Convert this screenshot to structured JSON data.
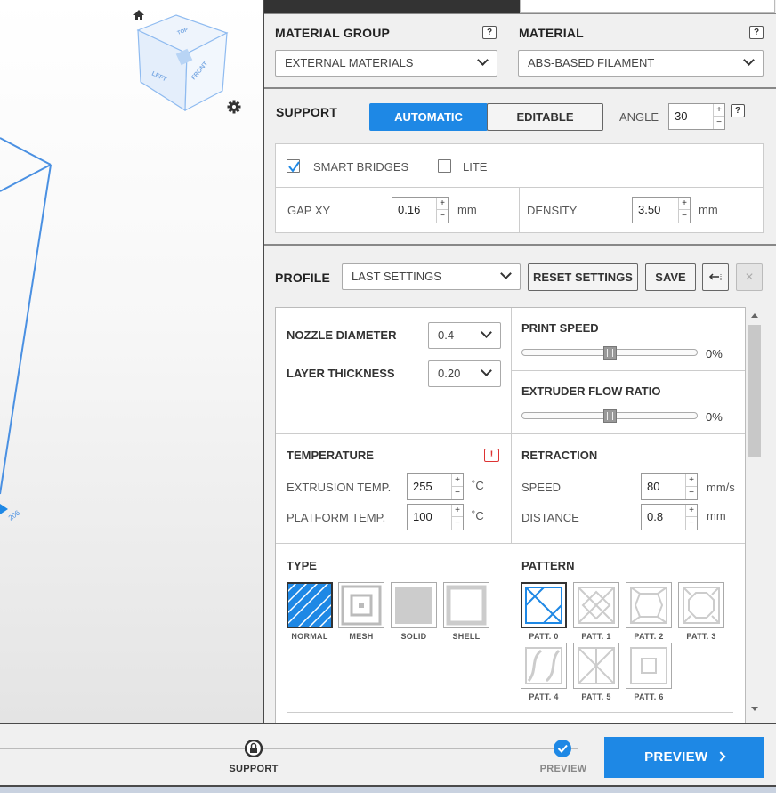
{
  "viewport": {
    "cube_labels": {
      "top": "TOP",
      "left": "LEFT",
      "front": "FRONT"
    },
    "axis_label": "206",
    "icons": [
      "home-icon",
      "gear-icon"
    ]
  },
  "material": {
    "group_label": "MATERIAL GROUP",
    "group_value": "EXTERNAL MATERIALS",
    "material_label": "MATERIAL",
    "material_value": "ABS-BASED FILAMENT",
    "help": "?"
  },
  "support": {
    "label": "SUPPORT",
    "tab_automatic": "AUTOMATIC",
    "tab_editable": "EDITABLE",
    "angle_label": "ANGLE",
    "angle_value": "30",
    "help": "?",
    "smart_bridges_label": "SMART BRIDGES",
    "smart_bridges_checked": true,
    "lite_label": "LITE",
    "lite_checked": false,
    "gap_label": "GAP XY",
    "gap_value": "0.16",
    "gap_unit": "mm",
    "density_label": "DENSITY",
    "density_value": "3.50",
    "density_unit": "mm"
  },
  "profile": {
    "label": "PROFILE",
    "value": "LAST SETTINGS",
    "reset_label": "RESET SETTINGS",
    "save_label": "SAVE",
    "close": "×"
  },
  "settings": {
    "nozzle_label": "NOZZLE DIAMETER",
    "nozzle_value": "0.4",
    "layer_label": "LAYER THICKNESS",
    "layer_value": "0.20",
    "print_speed_label": "PRINT SPEED",
    "print_speed_value": "0%",
    "print_speed_level": 0.5,
    "flow_label": "EXTRUDER FLOW RATIO",
    "flow_value": "0%",
    "flow_level": 0.5,
    "temperature_label": "TEMPERATURE",
    "warning": "!",
    "extrusion_label": "EXTRUSION TEMP.",
    "extrusion_value": "255",
    "platform_label": "PLATFORM TEMP.",
    "platform_value": "100",
    "temp_unit": "˚C",
    "retraction_label": "RETRACTION",
    "speed_label": "SPEED",
    "speed_value": "80",
    "speed_unit": "mm/s",
    "distance_label": "DISTANCE",
    "distance_value": "0.8",
    "distance_unit": "mm",
    "spin_up": "+",
    "spin_down": "−"
  },
  "infill": {
    "type_label": "TYPE",
    "types": [
      "NORMAL",
      "MESH",
      "SOLID",
      "SHELL"
    ],
    "selected_type": "NORMAL",
    "pattern_label": "PATTERN",
    "patterns": [
      "PATT. 0",
      "PATT. 1",
      "PATT. 2",
      "PATT. 3",
      "PATT. 4",
      "PATT. 5",
      "PATT. 6"
    ],
    "selected_pattern": "PATT. 0"
  },
  "steps": {
    "support_label": "SUPPORT",
    "preview_label": "PREVIEW",
    "preview_button": "PREVIEW"
  },
  "colors": {
    "accent": "#1e88e5",
    "warning": "#dd3333",
    "dark": "#333333"
  }
}
